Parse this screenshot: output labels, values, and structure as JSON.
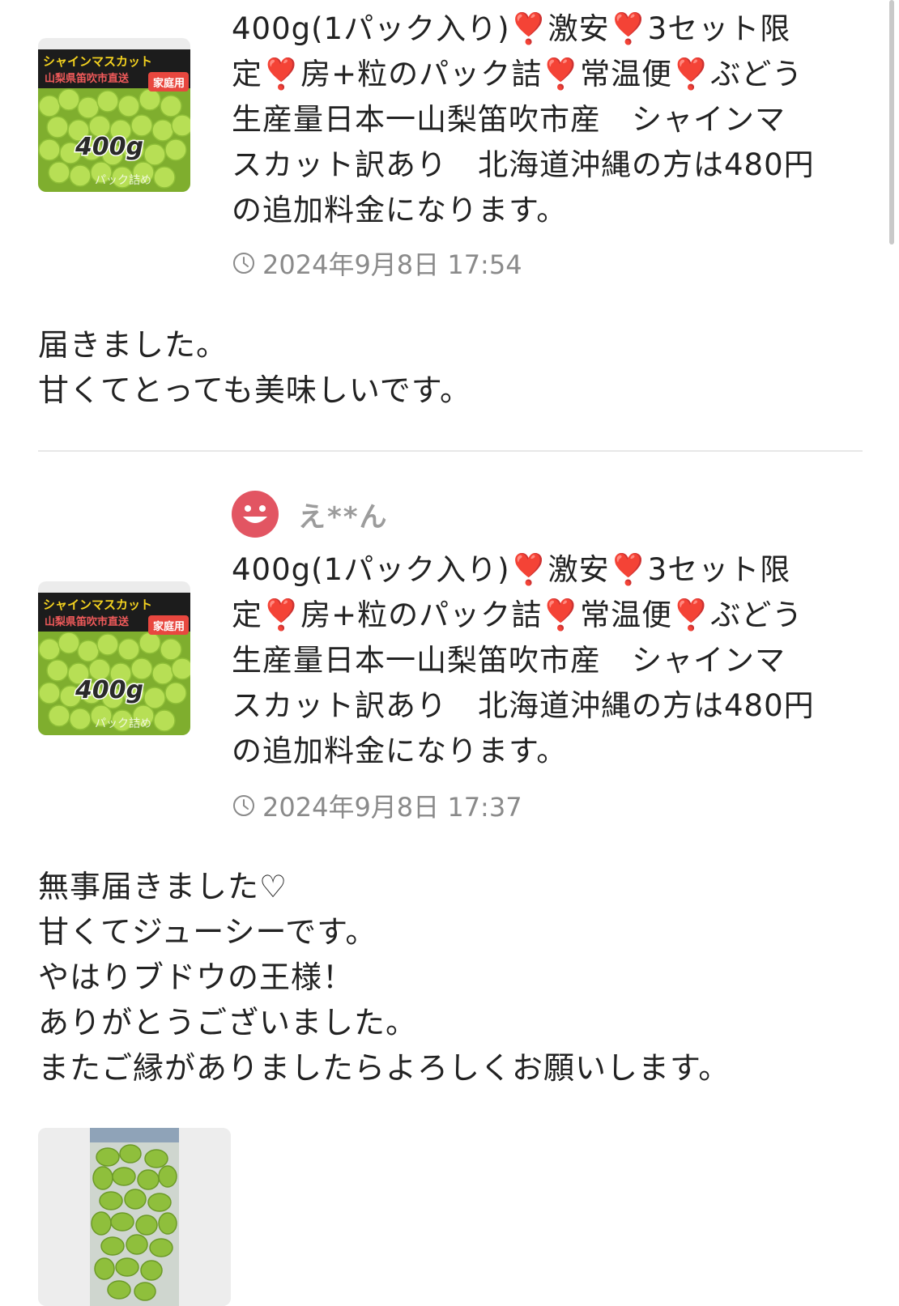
{
  "reviews": [
    {
      "title_lines": [
        "400g(1パック入り)❣️激安❣️3セット限",
        "定❣️房+粒のパック詰❣️常温便❣️ぶどう",
        "生産量日本一山梨笛吹市産　シャインマ",
        "スカット訳あり　北海道沖縄の方は480円",
        "の追加料金になります。"
      ],
      "thumbnail": {
        "banner": "シャインマスカット",
        "sub_banner": "山梨県笛吹市直送",
        "badge": "家庭用",
        "weight": "400g",
        "note": "パック詰め"
      },
      "date": "2024年9月8日 17:54",
      "comment_lines": [
        "届きました。",
        "甘くてとっても美味しいです。"
      ]
    },
    {
      "reviewer": "え**ん",
      "title_lines": [
        "400g(1パック入り)❣️激安❣️3セット限",
        "定❣️房+粒のパック詰❣️常温便❣️ぶどう",
        "生産量日本一山梨笛吹市産　シャインマ",
        "スカット訳あり　北海道沖縄の方は480円",
        "の追加料金になります。"
      ],
      "thumbnail": {
        "banner": "シャインマスカット",
        "sub_banner": "山梨県笛吹市直送",
        "badge": "家庭用",
        "weight": "400g",
        "note": "パック詰め"
      },
      "date": "2024年9月8日 17:37",
      "comment_lines": [
        "無事届きました♡",
        "甘くてジューシーです。",
        "やはりブドウの王様！",
        "ありがとうございました。",
        "またご縁がありましたらよろしくお願いします。"
      ]
    }
  ],
  "colors": {
    "accent_red": "#e25562",
    "muted_text": "#8a8a8a",
    "grape_green": "#9ccf3c"
  },
  "icons": [
    "clock-icon",
    "smiley-avatar-icon",
    "product-thumbnail",
    "grape-photo"
  ]
}
